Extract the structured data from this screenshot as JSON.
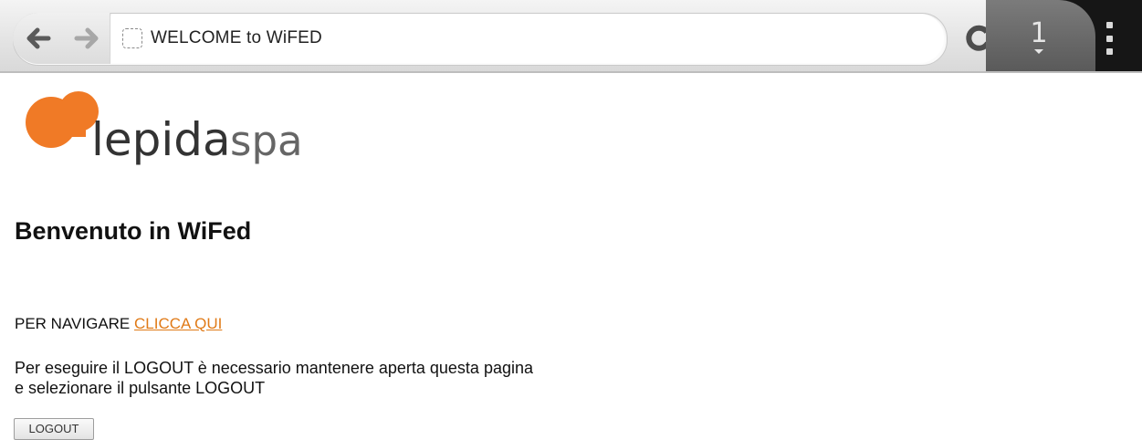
{
  "browser": {
    "tab_title": "WELCOME to WiFED",
    "tab_count": "1",
    "icons": {
      "back": "arrow-left-icon",
      "forward": "arrow-right-icon",
      "page": "page-placeholder-icon",
      "reload": "reload-icon",
      "menu": "overflow-menu-icon"
    }
  },
  "logo": {
    "main_text": "lepida",
    "suffix_text": "spa",
    "blob_color": "#f07a26",
    "text_color": "#333333",
    "suffix_color": "#666666"
  },
  "page": {
    "title": "Benvenuto in WiFed",
    "navigate_prefix": "PER NAVIGARE",
    "navigate_link": "CLICCA QUI",
    "logout_line1": "Per eseguire il LOGOUT è necessario mantenere aperta questa pagina",
    "logout_line2": "e selezionare il pulsante LOGOUT",
    "logout_button": "LOGOUT",
    "link_color": "#e07a17"
  }
}
